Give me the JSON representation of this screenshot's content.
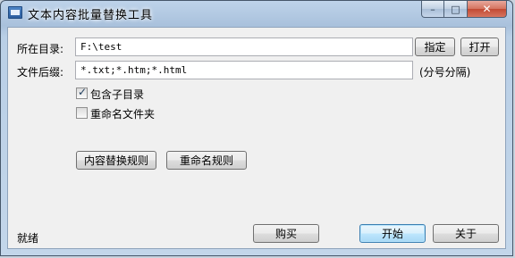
{
  "window": {
    "title": "文本内容批量替换工具",
    "controls": {
      "minimize": "–",
      "maximize": "□",
      "close": "✕"
    }
  },
  "form": {
    "dir_label": "所在目录:",
    "dir_value": "F:\\test",
    "browse_button": "指定",
    "open_button": "打开",
    "ext_label": "文件后缀:",
    "ext_value": "*.txt;*.htm;*.html",
    "ext_hint": "(分号分隔)",
    "include_subdirs_label": "包含子目录",
    "include_subdirs_checked": true,
    "rename_folders_label": "重命名文件夹",
    "rename_folders_checked": false
  },
  "rules": {
    "content_rules_button": "内容替换规则",
    "rename_rules_button": "重命名规则"
  },
  "footer": {
    "status": "就绪",
    "buy_button": "购买",
    "start_button": "开始",
    "about_button": "关于"
  }
}
